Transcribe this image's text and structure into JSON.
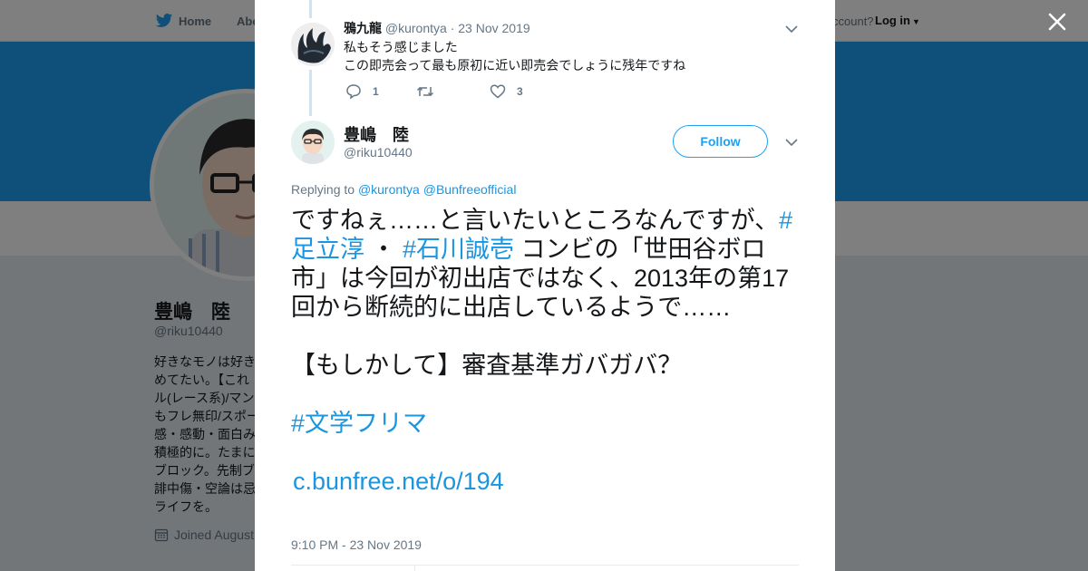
{
  "topnav": {
    "home_label": "Home",
    "about_label": "Abo",
    "account_prompt": "ccount?",
    "login_label": "Log in"
  },
  "profile": {
    "name": "豊嶋　陸",
    "handle": "@riku10440",
    "bio": "好きなモノは好き\nめてたい。【これ\nル(レース系)/マン\nもフレ無印/スポー\n感・感動・面白み\n積極的に。たまに\nブロック。先制ブ\n誹中傷・空論は忌\nライフを。",
    "joined": "Joined August"
  },
  "reply": {
    "name": "鴉九龍",
    "handle": "@kurontya",
    "separator": "·",
    "date": "23 Nov 2019",
    "text": "私もそう感じました\nこの即売会って最も原初に近い即売会でしょうに残年ですね",
    "reply_count": "1",
    "retweet_count": "",
    "like_count": "3"
  },
  "main": {
    "name": "豊嶋　陸",
    "handle": "@riku10440",
    "follow_label": "Follow",
    "replying_prefix": "Replying to",
    "replying_to": [
      "@kurontya",
      "@Bunfreeofficial"
    ],
    "text_1": "ですねぇ……と言いたいところなんですが、",
    "tag_1": "#足立淳",
    "text_2": " ・ ",
    "tag_2": "#石川誠壱",
    "text_3": " コンビの「世田谷ボロ市」は今回が初出店ではなく、2013年の第17回から断続的に出店しているようで……",
    "text_4": "【もしかして】審査基準ガバガバ？",
    "tag_3": "#文学フリマ",
    "link": "c.bunfree.net/o/194",
    "timestamp": "9:10 PM - 23 Nov 2019"
  },
  "colors": {
    "accent": "#1da1f2",
    "link": "#1b95e0",
    "text": "#14171a",
    "muted": "#657786"
  }
}
